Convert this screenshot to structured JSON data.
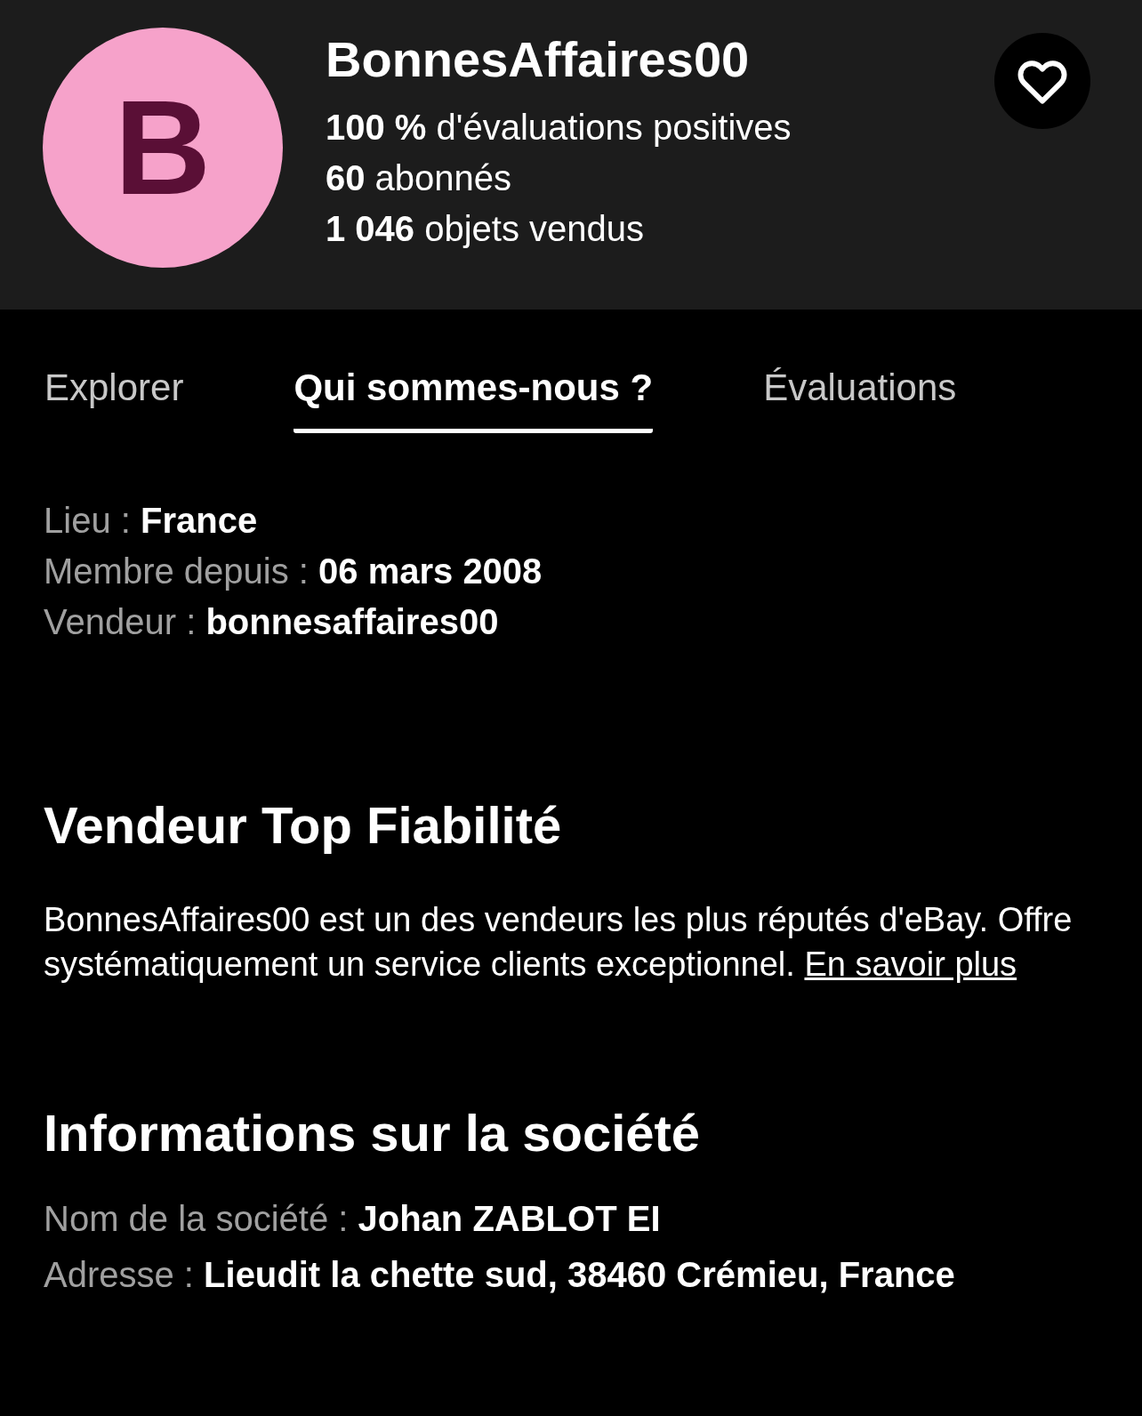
{
  "seller": {
    "avatar_letter": "B",
    "name": "BonnesAffaires00",
    "stats": [
      "**100 %** d'évaluations positives",
      "**60** abonnés",
      "**1 046** objets vendus"
    ],
    "favorite": {
      "selected": false
    }
  },
  "tabs": [
    {
      "label": "Explorer",
      "selected": false
    },
    {
      "label": "Qui sommes-nous ?",
      "selected": true
    },
    {
      "label": "Évaluations",
      "selected": false
    }
  ],
  "details": [
    "Lieu : **France**",
    "Membre depuis : **06 mars 2008**",
    "Vendeur : **bonnesaffaires00**"
  ],
  "top_rated": {
    "title": "Vendeur Top Fiabilité",
    "text": "BonnesAffaires00 est un des vendeurs les plus réputés d'eBay. Offre systématiquement un service clients exceptionnel.",
    "link": "En savoir plus"
  },
  "company": {
    "title": "Informations sur la société",
    "rows": [
      "Nom de la société : **Johan ZABLOT EI**",
      "Adresse : **Lieudit la chette sud, 38460 Crémieu, France**"
    ]
  }
}
